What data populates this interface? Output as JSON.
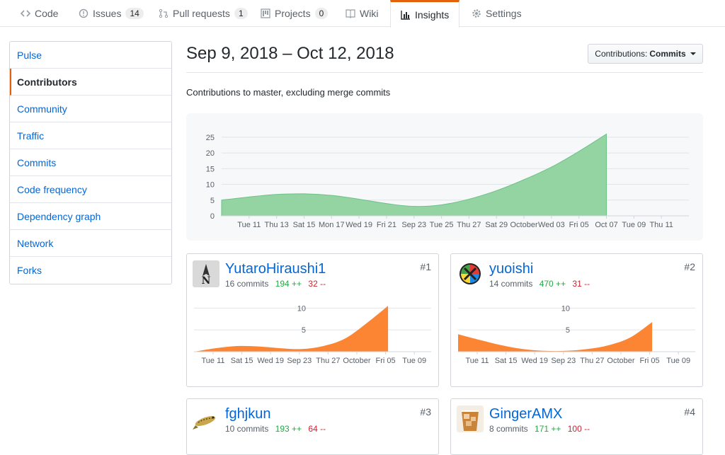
{
  "tabs": [
    {
      "label": "Code",
      "icon": "code-icon",
      "counter": ""
    },
    {
      "label": "Issues",
      "icon": "issue-icon",
      "counter": "14"
    },
    {
      "label": "Pull requests",
      "icon": "pull-request-icon",
      "counter": "1"
    },
    {
      "label": "Projects",
      "icon": "project-icon",
      "counter": "0"
    },
    {
      "label": "Wiki",
      "icon": "book-icon",
      "counter": ""
    },
    {
      "label": "Insights",
      "icon": "graph-icon",
      "counter": ""
    },
    {
      "label": "Settings",
      "icon": "gear-icon",
      "counter": ""
    }
  ],
  "sidebar": {
    "items": [
      {
        "label": "Pulse"
      },
      {
        "label": "Contributors"
      },
      {
        "label": "Community"
      },
      {
        "label": "Traffic"
      },
      {
        "label": "Commits"
      },
      {
        "label": "Code frequency"
      },
      {
        "label": "Dependency graph"
      },
      {
        "label": "Network"
      },
      {
        "label": "Forks"
      }
    ],
    "selected": "Contributors"
  },
  "header": {
    "title": "Sep 9, 2018 – Oct 12, 2018",
    "dropdown_prefix": "Contributions:",
    "dropdown_value": "Commits",
    "subtitle": "Contributions to master, excluding merge commits"
  },
  "colors": {
    "accent": "#e36209",
    "link": "#0366d6",
    "main_area": "#94d3a2",
    "main_area_stroke": "#6cc287",
    "user_area": "#fb8532",
    "additions": "#28a745",
    "deletions": "#cb2431"
  },
  "chart_data": [
    {
      "type": "area",
      "title": "",
      "x": [
        "2018-09-09",
        "2018-09-11",
        "2018-09-13",
        "2018-09-15",
        "2018-09-17",
        "2018-09-19",
        "2018-09-21",
        "2018-09-23",
        "2018-09-25",
        "2018-09-27",
        "2018-09-29",
        "2018-10-01",
        "2018-10-03",
        "2018-10-05",
        "2018-10-07",
        "2018-10-09",
        "2018-10-11",
        "2018-10-12"
      ],
      "y": [
        5,
        6,
        6.8,
        7,
        6.5,
        5.3,
        3.9,
        3,
        3.5,
        5.3,
        8,
        11.5,
        15.5,
        20.5,
        26,
        null,
        null,
        null
      ],
      "xtick_labels": [
        "Tue 11",
        "Thu 13",
        "Sat 15",
        "Mon 17",
        "Wed 19",
        "Fri 21",
        "Sep 23",
        "Tue 25",
        "Thu 27",
        "Sat 29",
        "October",
        "Wed 03",
        "Fri 05",
        "Oct 07",
        "Tue 09",
        "Thu 11"
      ],
      "ytick_labels": [
        "0",
        "5",
        "10",
        "15",
        "20",
        "25"
      ],
      "ylim": [
        0,
        27
      ]
    }
  ],
  "contributors": [
    {
      "rank": "#1",
      "name": "YutaroHiraushi1",
      "commits": "16 commits",
      "additions": "194 ++",
      "deletions": "32 --",
      "avatar_icon": "compass-avatar-icon",
      "chart": {
        "type": "area",
        "y": [
          0,
          0.8,
          1.3,
          1.2,
          0.8,
          0.6,
          1.3,
          3,
          6.5,
          10.5,
          null,
          null
        ],
        "ytick_labels": [
          "5",
          "10"
        ],
        "ylim": [
          0,
          12
        ],
        "xtick_labels": [
          "Tue 11",
          "Sat 15",
          "Wed 19",
          "Sep 23",
          "Thu 27",
          "October",
          "Fri 05",
          "Tue 09"
        ]
      }
    },
    {
      "rank": "#2",
      "name": "yuoishi",
      "commits": "14 commits",
      "additions": "470 ++",
      "deletions": "31 --",
      "avatar_icon": "circle-avatar-icon",
      "chart": {
        "type": "area",
        "y": [
          4,
          2.7,
          1.5,
          0.6,
          0.2,
          0.2,
          0.6,
          1.5,
          3.3,
          6.8,
          null,
          null
        ],
        "ytick_labels": [
          "5",
          "10"
        ],
        "ylim": [
          0,
          12
        ],
        "xtick_labels": [
          "Tue 11",
          "Sat 15",
          "Wed 19",
          "Sep 23",
          "Thu 27",
          "October",
          "Fri 05",
          "Tue 09"
        ]
      }
    },
    {
      "rank": "#3",
      "name": "fghjkun",
      "commits": "10 commits",
      "additions": "193 ++",
      "deletions": "64 --",
      "avatar_icon": "fish-avatar-icon",
      "chart": null
    },
    {
      "rank": "#4",
      "name": "GingerAMX",
      "commits": "8 commits",
      "additions": "171 ++",
      "deletions": "100 --",
      "avatar_icon": "drink-avatar-icon",
      "chart": null
    }
  ]
}
